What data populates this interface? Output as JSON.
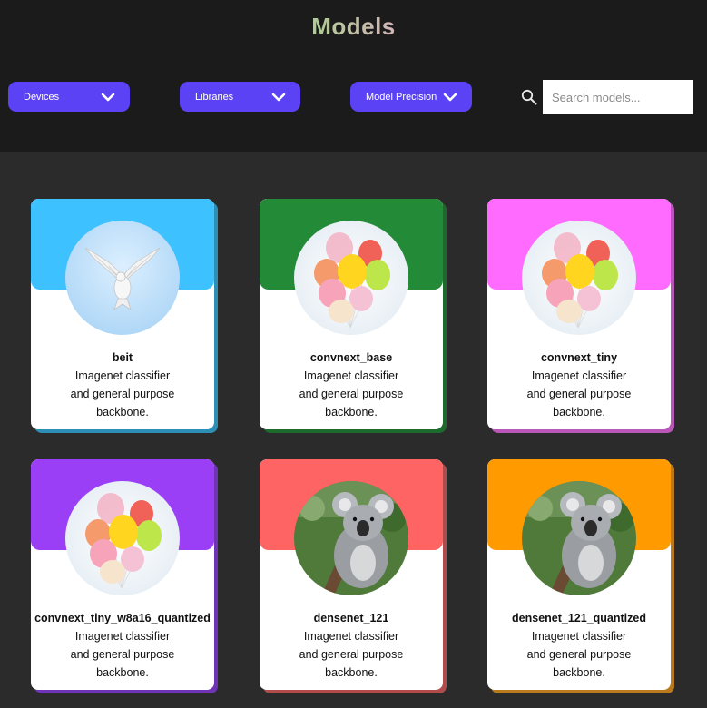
{
  "header": {
    "title": "Models",
    "filters": [
      {
        "label": "Devices"
      },
      {
        "label": "Libraries"
      },
      {
        "label": "Model Precision"
      }
    ],
    "search": {
      "placeholder": "Search models...",
      "value": ""
    }
  },
  "cards": [
    {
      "name": "beit",
      "desc1": "Imagenet classifier",
      "desc2": "and general purpose",
      "desc3": "backbone.",
      "color": "#3ec2ff",
      "shadow": "#2d8fb5",
      "image": "dove"
    },
    {
      "name": "convnext_base",
      "desc1": "Imagenet classifier",
      "desc2": "and general purpose",
      "desc3": "backbone.",
      "color": "#238a38",
      "shadow": "#1c6a2c",
      "image": "balloons"
    },
    {
      "name": "convnext_tiny",
      "desc1": "Imagenet classifier",
      "desc2": "and general purpose",
      "desc3": "backbone.",
      "color": "#ff6bff",
      "shadow": "#b857b8",
      "image": "balloons"
    },
    {
      "name": "convnext_tiny_w8a16_quantized",
      "desc1": "Imagenet classifier",
      "desc2": "and general purpose",
      "desc3": "backbone.",
      "color": "#9b3ff7",
      "shadow": "#6f34b5",
      "image": "balloons"
    },
    {
      "name": "densenet_121",
      "desc1": "Imagenet classifier",
      "desc2": "and general purpose",
      "desc3": "backbone.",
      "color": "#ff6464",
      "shadow": "#b24c4c",
      "image": "koala"
    },
    {
      "name": "densenet_121_quantized",
      "desc1": "Imagenet classifier",
      "desc2": "and general purpose",
      "desc3": "backbone.",
      "color": "#ff9a00",
      "shadow": "#b87a1c",
      "image": "koala"
    }
  ]
}
